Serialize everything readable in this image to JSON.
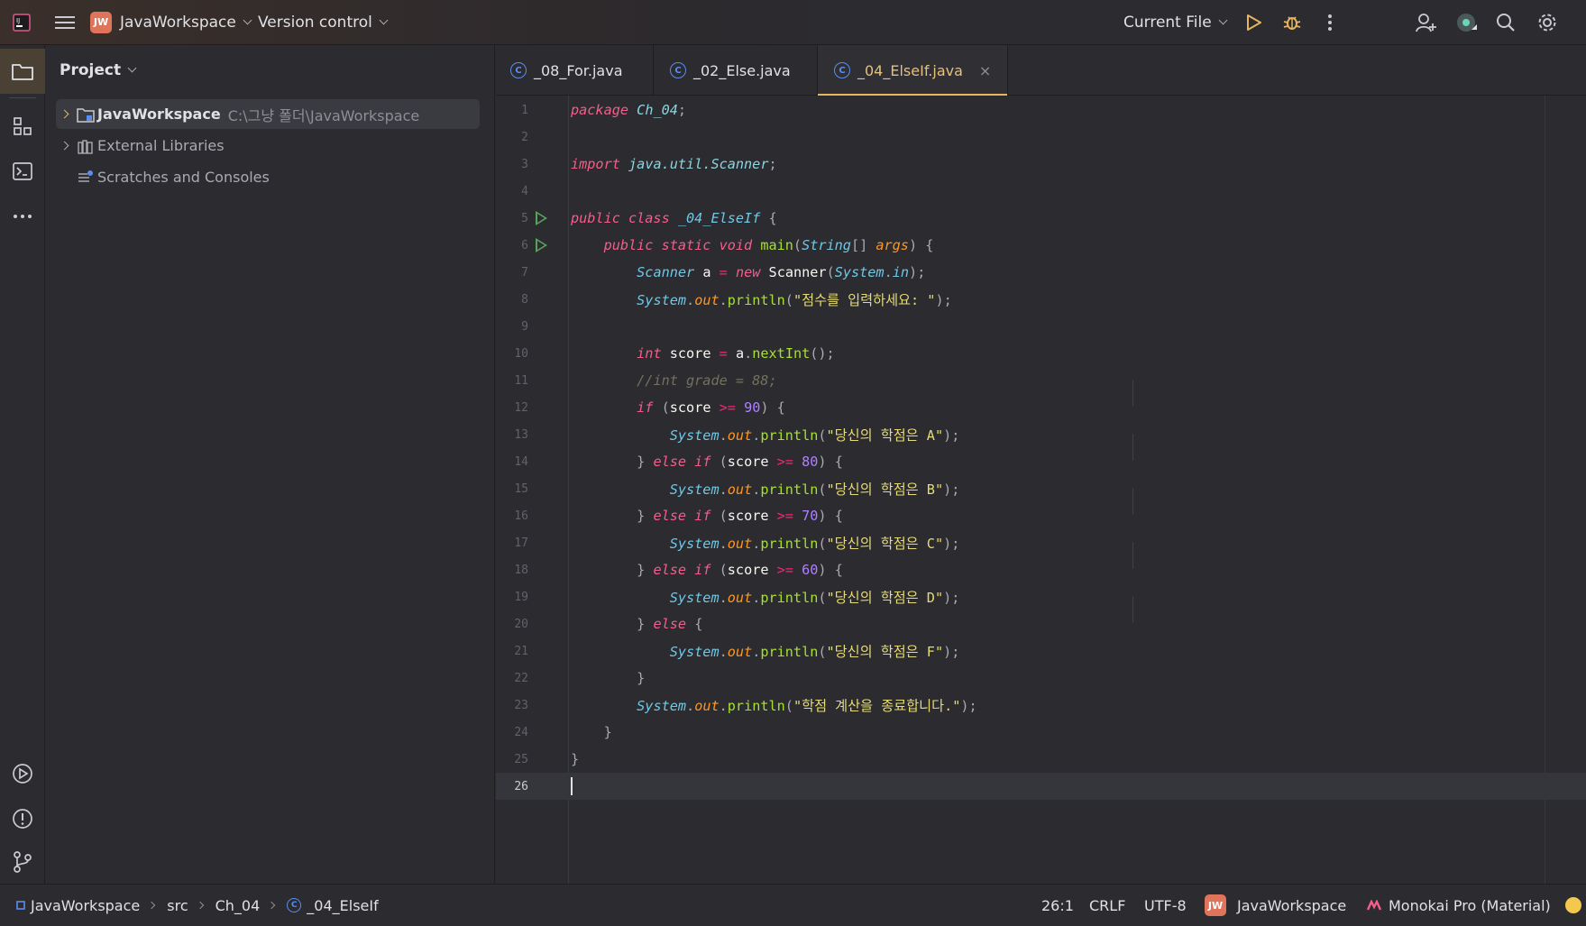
{
  "topbar": {
    "project_badge": "JW",
    "project_name": "JavaWorkspace",
    "vcs_label": "Version control",
    "run_config": "Current File",
    "colors": {
      "badge": "#e0745b",
      "run": "#e8b45c",
      "accent": "#e8b45c"
    }
  },
  "project_panel": {
    "title": "Project",
    "tree": [
      {
        "label": "JavaWorkspace",
        "path": "C:\\그냥 폴더\\JavaWorkspace"
      },
      {
        "label": "External Libraries"
      },
      {
        "label": "Scratches and Consoles"
      }
    ]
  },
  "tabs": [
    {
      "label": "_08_For.java",
      "active": false
    },
    {
      "label": "_02_Else.java",
      "active": false
    },
    {
      "label": "_04_ElseIf.java",
      "active": true,
      "close": "×"
    }
  ],
  "editor": {
    "line_numbers": [
      "1",
      "2",
      "3",
      "4",
      "5",
      "6",
      "7",
      "8",
      "9",
      "10",
      "11",
      "12",
      "13",
      "14",
      "15",
      "16",
      "17",
      "18",
      "19",
      "20",
      "21",
      "22",
      "23",
      "24",
      "25",
      "26"
    ],
    "strings": {
      "prompt": "\"점수를 입력하세요: \"",
      "a": "\"당신의 학점은 A\"",
      "b": "\"당신의 학점은 B\"",
      "c": "\"당신의 학점은 C\"",
      "d": "\"당신의 학점은 D\"",
      "f": "\"당신의 학점은 F\"",
      "end": "\"학점 계산을 종료합니다.\""
    },
    "tokens": {
      "package_kw": "package",
      "package_name": "Ch_04",
      "import_kw": "import",
      "import_name": "java.util.Scanner",
      "class_decl": "public class",
      "class_name": "_04_ElseIf",
      "method_kw": "public static void",
      "method_name": "main",
      "string_type": "String",
      "args": "args",
      "scanner": "Scanner",
      "var_a": "a",
      "new_kw": "new",
      "system": "System",
      "in": "in",
      "out": "out",
      "println": "println",
      "int_kw": "int",
      "score": "score",
      "nextInt": "nextInt",
      "comment": "//int grade = 88;",
      "if_kw": "if",
      "else_if_kw": "else if",
      "else_kw": "else",
      "n90": "90",
      "n80": "80",
      "n70": "70",
      "n60": "60"
    },
    "current_line": "26"
  },
  "statusbar": {
    "breadcrumbs": [
      "JavaWorkspace",
      "src",
      "Ch_04",
      "_04_ElseIf"
    ],
    "position": "26:1",
    "line_sep": "CRLF",
    "encoding": "UTF-8",
    "badge": "JW",
    "project": "JavaWorkspace",
    "theme": "Monokai Pro (Material)"
  }
}
